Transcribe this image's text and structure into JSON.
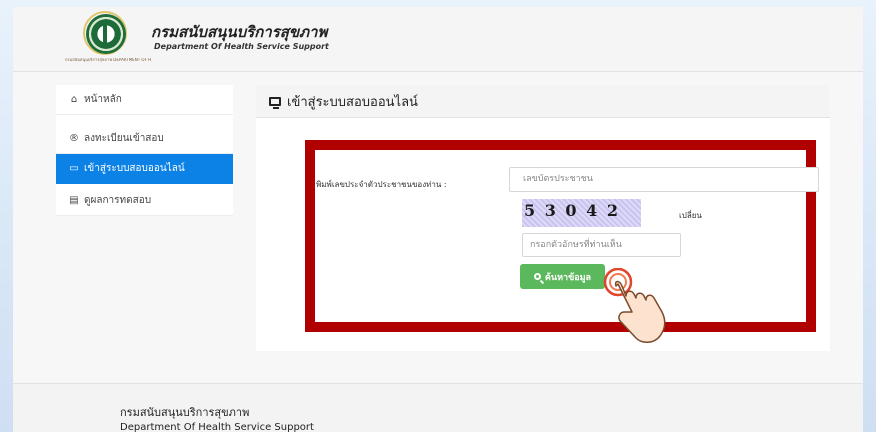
{
  "header": {
    "title_th": "กรมสนับสนุนบริการสุขภาพ",
    "title_en": "Department Of Health Service Support",
    "logo_caption": "กรมสนับสนุนบริการสุขภาพ DEPARTMENT OF HEALTH SERVICE SUPPORT"
  },
  "sidebar": {
    "items": [
      {
        "label": "หน้าหลัก",
        "icon": "home-icon",
        "glyph": "⌂"
      },
      {
        "label": "ลงทะเบียนเข้าสอบ",
        "icon": "registered-icon",
        "glyph": "®"
      },
      {
        "label": "เข้าสู่ระบบสอบออนไลน์",
        "icon": "monitor-icon",
        "glyph": "▭"
      },
      {
        "label": "ดูผลการทดสอบ",
        "icon": "list-icon",
        "glyph": "▤"
      }
    ]
  },
  "panel": {
    "title": "เข้าสู่ระบบสอบออนไลน์",
    "id_label": "พิมพ์เลขประจำตัวประชาชนของท่าน :",
    "id_placeholder": "เลขบัตรประชาชน",
    "captcha_text": "5 3 0 4 2",
    "refresh_label": "เปลี่ยน",
    "captcha_placeholder": "กรอกตัวอักษรที่ท่านเห็น",
    "search_label": "ค้นหาข้อมูล"
  },
  "footer": {
    "line1": "กรมสนับสนุนบริการสุขภาพ",
    "line2": "Department Of Health Service Support"
  },
  "colors": {
    "accent": "#0d82e6",
    "highlight_frame": "#b00000",
    "search_button": "#5cb85c"
  }
}
